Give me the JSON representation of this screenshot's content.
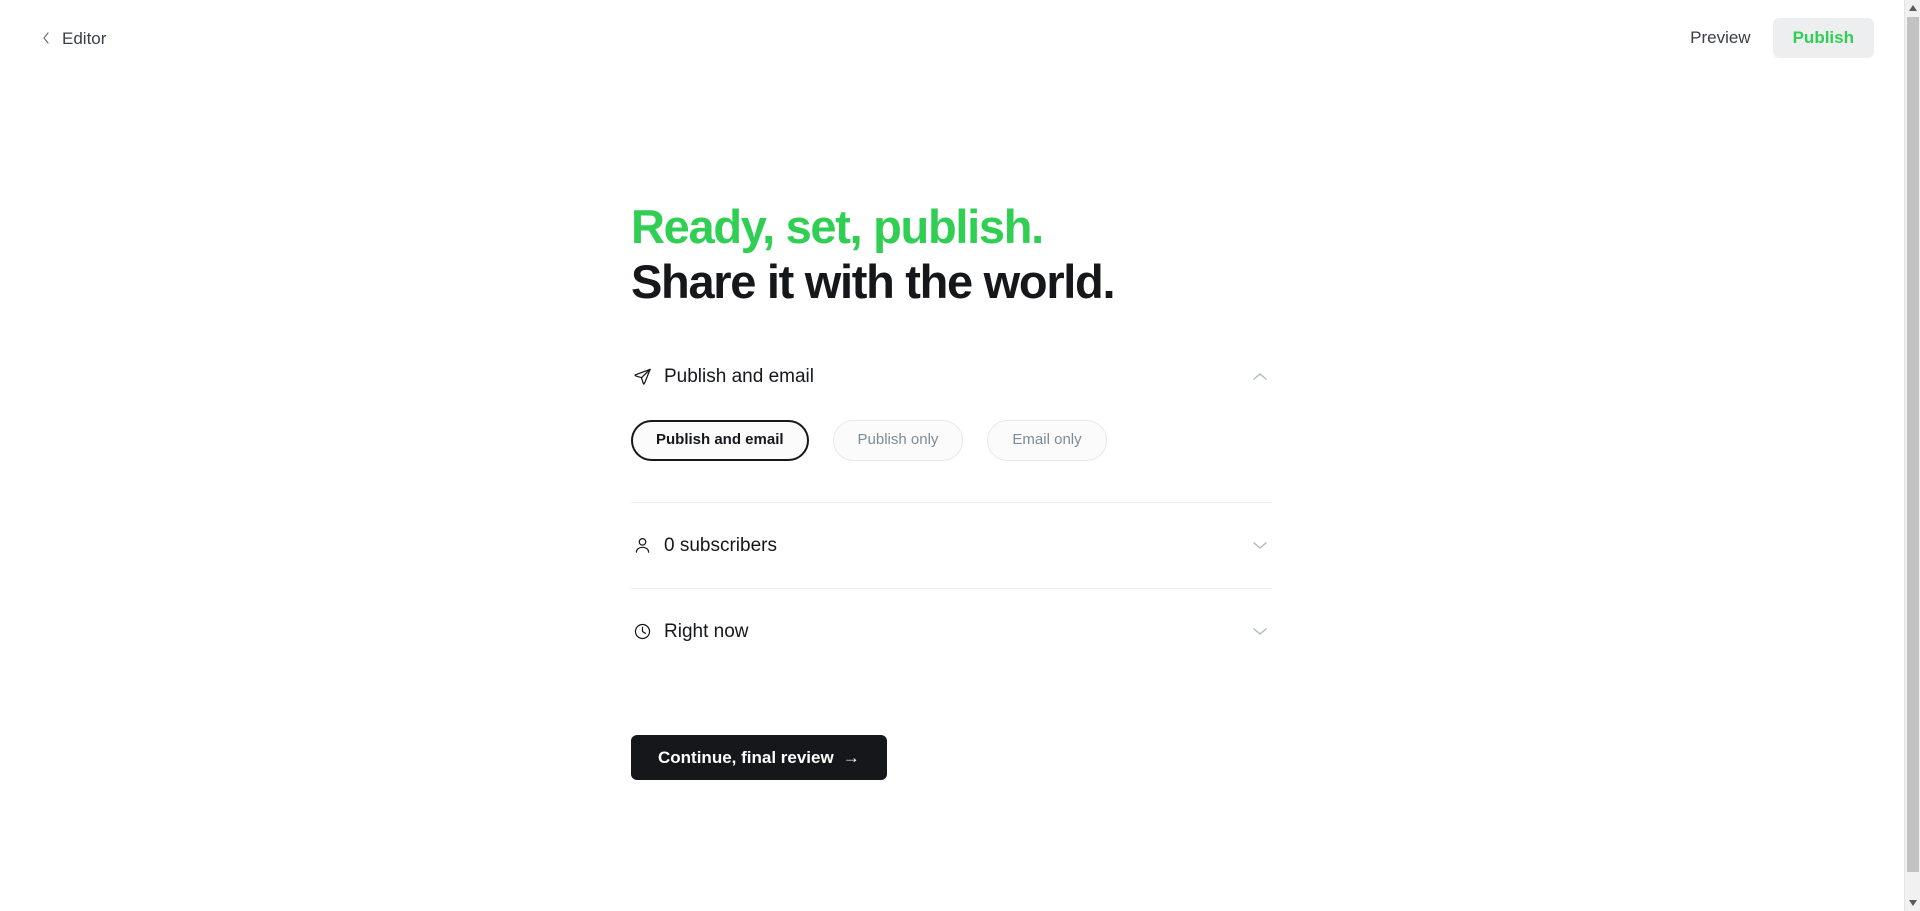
{
  "topbar": {
    "back_label": "Editor",
    "back_icon": "chevron-left-icon",
    "preview_label": "Preview",
    "publish_label": "Publish",
    "publish_text_color": "#30cf53",
    "publish_bg_color": "#eceef0"
  },
  "hero": {
    "line1": "Ready, set, publish.",
    "line2": "Share it with the world.",
    "line1_color": "#30cf53",
    "line2_color": "#15171a"
  },
  "sections": [
    {
      "key": "publish_and_email",
      "icon": "send-icon",
      "title": "Publish and email",
      "chevron": "chevron-up-icon",
      "expanded": true
    },
    {
      "key": "subscribers",
      "icon": "user-icon",
      "title": "0 subscribers",
      "chevron": "chevron-down-icon",
      "expanded": false
    },
    {
      "key": "schedule",
      "icon": "clock-icon",
      "title": "Right now",
      "chevron": "chevron-down-icon",
      "expanded": false
    }
  ],
  "delivery_options": [
    {
      "label": "Publish and email",
      "selected": true
    },
    {
      "label": "Publish only",
      "selected": false
    },
    {
      "label": "Email only",
      "selected": false
    }
  ],
  "cta": {
    "label": "Continue, final review",
    "arrow": "→",
    "bg_color": "#15171a"
  },
  "scrollbar": {
    "up_arrow": "▲",
    "down_arrow": "▼"
  }
}
